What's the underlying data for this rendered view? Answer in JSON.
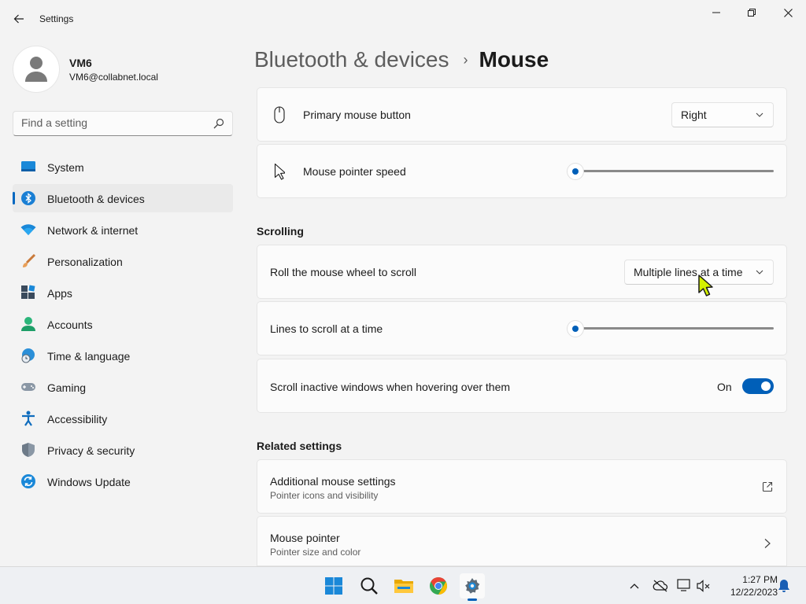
{
  "window": {
    "title": "Settings",
    "controls": [
      "minimize",
      "maximize",
      "close"
    ]
  },
  "profile": {
    "name": "VM6",
    "email": "VM6@collabnet.local"
  },
  "search": {
    "placeholder": "Find a setting",
    "value": ""
  },
  "sidebar": {
    "items": [
      {
        "label": "System",
        "icon": "system-icon",
        "active": false
      },
      {
        "label": "Bluetooth & devices",
        "icon": "bluetooth-icon",
        "active": true
      },
      {
        "label": "Network & internet",
        "icon": "wifi-icon",
        "active": false
      },
      {
        "label": "Personalization",
        "icon": "brush-icon",
        "active": false
      },
      {
        "label": "Apps",
        "icon": "apps-icon",
        "active": false
      },
      {
        "label": "Accounts",
        "icon": "accounts-icon",
        "active": false
      },
      {
        "label": "Time & language",
        "icon": "globe-clock-icon",
        "active": false
      },
      {
        "label": "Gaming",
        "icon": "gamepad-icon",
        "active": false
      },
      {
        "label": "Accessibility",
        "icon": "accessibility-icon",
        "active": false
      },
      {
        "label": "Privacy & security",
        "icon": "shield-icon",
        "active": false
      },
      {
        "label": "Windows Update",
        "icon": "update-icon",
        "active": false
      }
    ]
  },
  "breadcrumb": {
    "parent": "Bluetooth & devices",
    "separator": "›",
    "current": "Mouse"
  },
  "settings": {
    "primary_button": {
      "label": "Primary mouse button",
      "value": "Right"
    },
    "pointer_speed": {
      "label": "Mouse pointer speed",
      "value_fraction": 0.0
    }
  },
  "scrolling": {
    "title": "Scrolling",
    "roll_wheel": {
      "label": "Roll the mouse wheel to scroll",
      "value": "Multiple lines at a time"
    },
    "lines": {
      "label": "Lines to scroll at a time",
      "value_fraction": 0.0
    },
    "inactive": {
      "label": "Scroll inactive windows when hovering over them",
      "state": "On",
      "on": true
    }
  },
  "related": {
    "title": "Related settings",
    "items": [
      {
        "label": "Additional mouse settings",
        "sub": "Pointer icons and visibility",
        "action": "external-link-icon"
      },
      {
        "label": "Mouse pointer",
        "sub": "Pointer size and color",
        "action": "chevron-right-icon"
      }
    ]
  },
  "taskbar": {
    "apps": [
      "start-icon",
      "search-icon",
      "file-explorer-icon",
      "chrome-icon",
      "settings-icon"
    ],
    "clock": {
      "time": "1:27 PM",
      "date": "12/22/2023"
    }
  },
  "colors": {
    "accent": "#005fb8",
    "background": "#f3f3f3",
    "card": "#fbfbfb",
    "cursor": "#d4f000"
  }
}
